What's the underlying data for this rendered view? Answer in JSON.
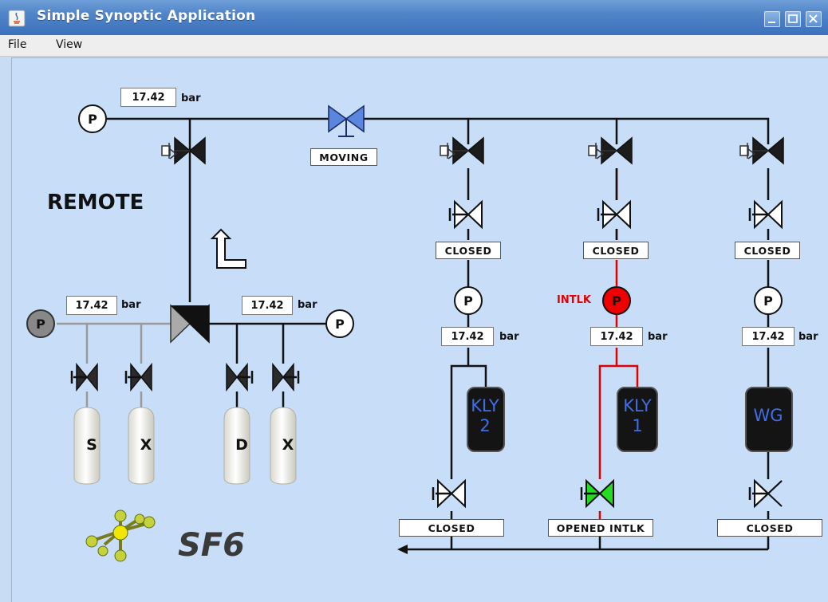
{
  "window": {
    "title": "Simple Synoptic Application",
    "controls": [
      "minimize-icon",
      "maximize-icon",
      "close-icon"
    ]
  },
  "menu": {
    "items": [
      "File",
      "View"
    ]
  },
  "synoptic": {
    "mode_label": "REMOTE",
    "main_gauge": {
      "symbol": "P",
      "value": "17.42",
      "unit": "bar"
    },
    "isolation_valve": {
      "state": "MOVING"
    },
    "left_manifold": {
      "symbol": "P",
      "value": "17.42",
      "unit": "bar"
    },
    "right_manifold": {
      "symbol": "P",
      "value": "17.42",
      "unit": "bar"
    },
    "bottles": [
      "S",
      "X",
      "D",
      "X"
    ],
    "branches": [
      {
        "upper_valve_state": "CLOSED",
        "gauge": {
          "symbol": "P",
          "value": "17.42",
          "unit": "bar"
        },
        "device": "KLY\n2",
        "lower_valve_state": "CLOSED"
      },
      {
        "upper_valve_state": "CLOSED",
        "interlock": "INTLK",
        "gauge": {
          "symbol": "P",
          "value": "17.42",
          "unit": "bar"
        },
        "device": "KLY\n1",
        "lower_valve_state": "OPENED INTLK"
      },
      {
        "upper_valve_state": "CLOSED",
        "gauge": {
          "symbol": "P",
          "value": "17.42",
          "unit": "bar"
        },
        "device": "WG",
        "lower_valve_state": "CLOSED"
      }
    ],
    "gas_label": "SF6"
  },
  "colors": {
    "titlebar": "#4f84c8",
    "canvas": "#c8def8",
    "interlock": "#e00000",
    "opened_valve": "#22dd22",
    "moving_valve": "#5b86e0",
    "device_text": "#3f6fe8"
  }
}
